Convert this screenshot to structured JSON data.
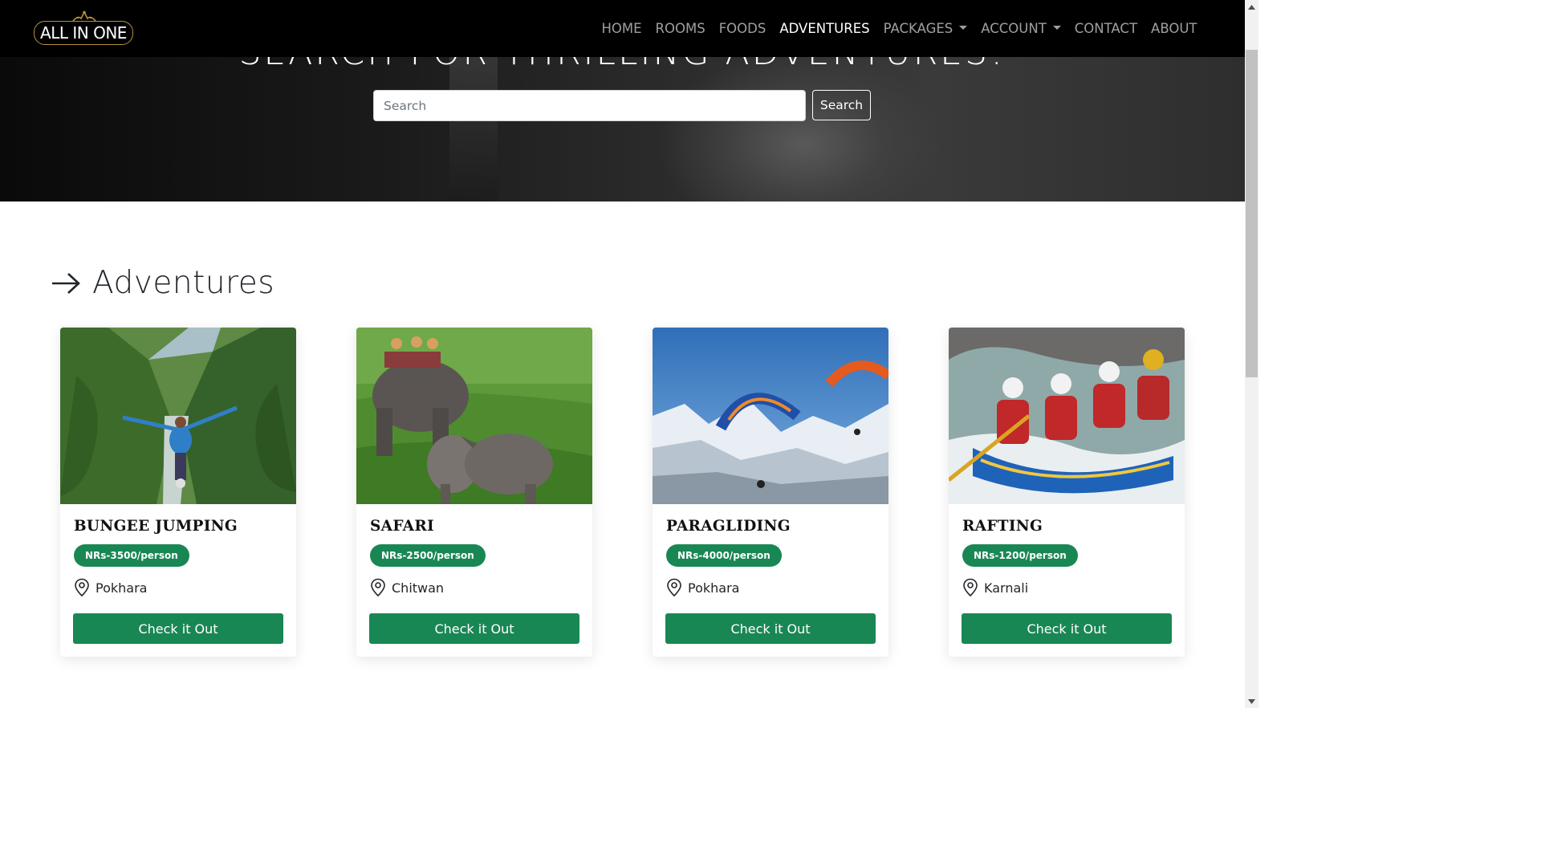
{
  "brand": {
    "logo_text": "ALL IN ONE"
  },
  "nav": {
    "items": [
      {
        "label": "HOME",
        "active": false,
        "dropdown": false
      },
      {
        "label": "ROOMS",
        "active": false,
        "dropdown": false
      },
      {
        "label": "FOODS",
        "active": false,
        "dropdown": false
      },
      {
        "label": "ADVENTURES",
        "active": true,
        "dropdown": false
      },
      {
        "label": "PACKAGES",
        "active": false,
        "dropdown": true
      },
      {
        "label": "ACCOUNT",
        "active": false,
        "dropdown": true
      },
      {
        "label": "CONTACT",
        "active": false,
        "dropdown": false
      },
      {
        "label": "ABOUT",
        "active": false,
        "dropdown": false
      }
    ]
  },
  "hero": {
    "title": "SEARCH FOR THRILLING ADVENTURES!",
    "search_placeholder": "Search",
    "search_value": "",
    "search_button": "Search"
  },
  "section": {
    "title": "Adventures",
    "icon": "arrow-right-icon"
  },
  "cards": [
    {
      "title": "BUNGEE JUMPING",
      "price": "NRs-3500/person",
      "location": "Pokhara",
      "button": "Check it Out",
      "image": "bungee-jumping-gorge"
    },
    {
      "title": "SAFARI",
      "price": "NRs-2500/person",
      "location": "Chitwan",
      "button": "Check it Out",
      "image": "elephant-rhino-grassland"
    },
    {
      "title": "PARAGLIDING",
      "price": "NRs-4000/person",
      "location": "Pokhara",
      "button": "Check it Out",
      "image": "paragliders-snow-mountains"
    },
    {
      "title": "RAFTING",
      "price": "NRs-1200/person",
      "location": "Karnali",
      "button": "Check it Out",
      "image": "river-rafting-team"
    }
  ],
  "colors": {
    "accent_green": "#198754",
    "navbar_bg": "#000000",
    "logo_gold": "#b8923b"
  }
}
